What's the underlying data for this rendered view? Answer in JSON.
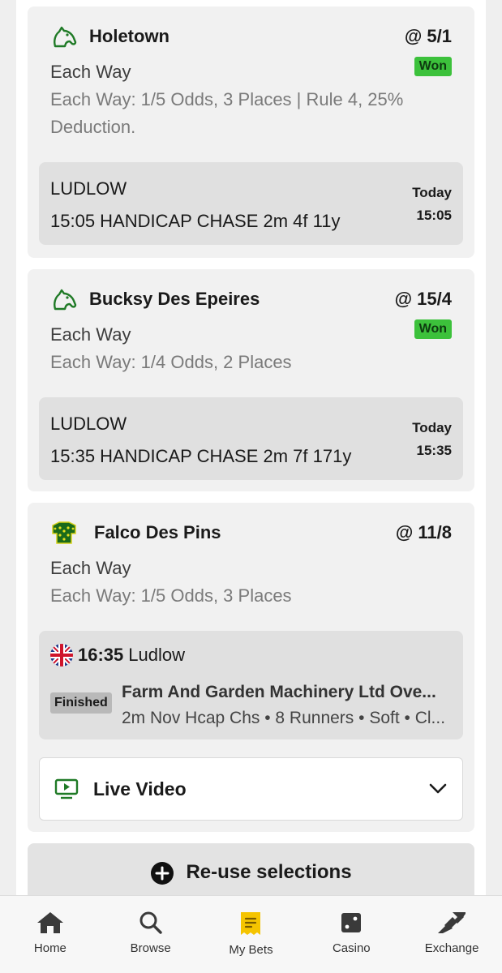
{
  "colors": {
    "accent_green": "#3cc13b",
    "page_bg": "#efefef",
    "card_bg": "#f1f1f1",
    "race_bg": "#e0e0e0",
    "mybets_yellow": "#f5c400"
  },
  "bets": [
    {
      "icon": "horse-head-icon",
      "name": "Holetown",
      "odds": "@ 5/1",
      "market": "Each Way",
      "status": "Won",
      "terms": "Each Way: 1/5 Odds, 3 Places | Rule 4, 25% Deduction.",
      "race": {
        "course": "LUDLOW",
        "title": "15:05 HANDICAP CHASE 2m 4f 11y",
        "day": "Today",
        "time": "15:05"
      }
    },
    {
      "icon": "horse-head-icon",
      "name": "Bucksy Des Epeires",
      "odds": "@ 15/4",
      "market": "Each Way",
      "status": "Won",
      "terms": "Each Way: 1/4 Odds, 2 Places",
      "race": {
        "course": "LUDLOW",
        "title": "15:35 HANDICAP CHASE 2m 7f 171y",
        "day": "Today",
        "time": "15:35"
      }
    },
    {
      "icon": "jockey-silks-icon",
      "name": "Falco Des Pins",
      "odds": "@ 11/8",
      "market": "Each Way",
      "terms": "Each Way: 1/5 Odds, 3 Places",
      "event": {
        "flag": "uk-flag-icon",
        "time": "16:35",
        "course": "Ludlow",
        "status": "Finished",
        "title": "Farm And Garden Machinery Ltd Ove...",
        "details": "2m Nov Hcap Chs • 8 Runners • Soft • Cl..."
      },
      "live_video": {
        "label": "Live Video",
        "icon": "tv-play-icon",
        "chevron": "chevron-down-icon"
      }
    }
  ],
  "reuse": {
    "label": "Re-use selections",
    "icon": "plus-circle-icon"
  },
  "nav": [
    {
      "label": "Home",
      "icon": "home-icon",
      "active": false
    },
    {
      "label": "Browse",
      "icon": "search-icon",
      "active": false
    },
    {
      "label": "My Bets",
      "icon": "ticket-icon",
      "active": true
    },
    {
      "label": "Casino",
      "icon": "dice-icon",
      "active": false
    },
    {
      "label": "Exchange",
      "icon": "exchange-arrows-icon",
      "active": false
    }
  ]
}
